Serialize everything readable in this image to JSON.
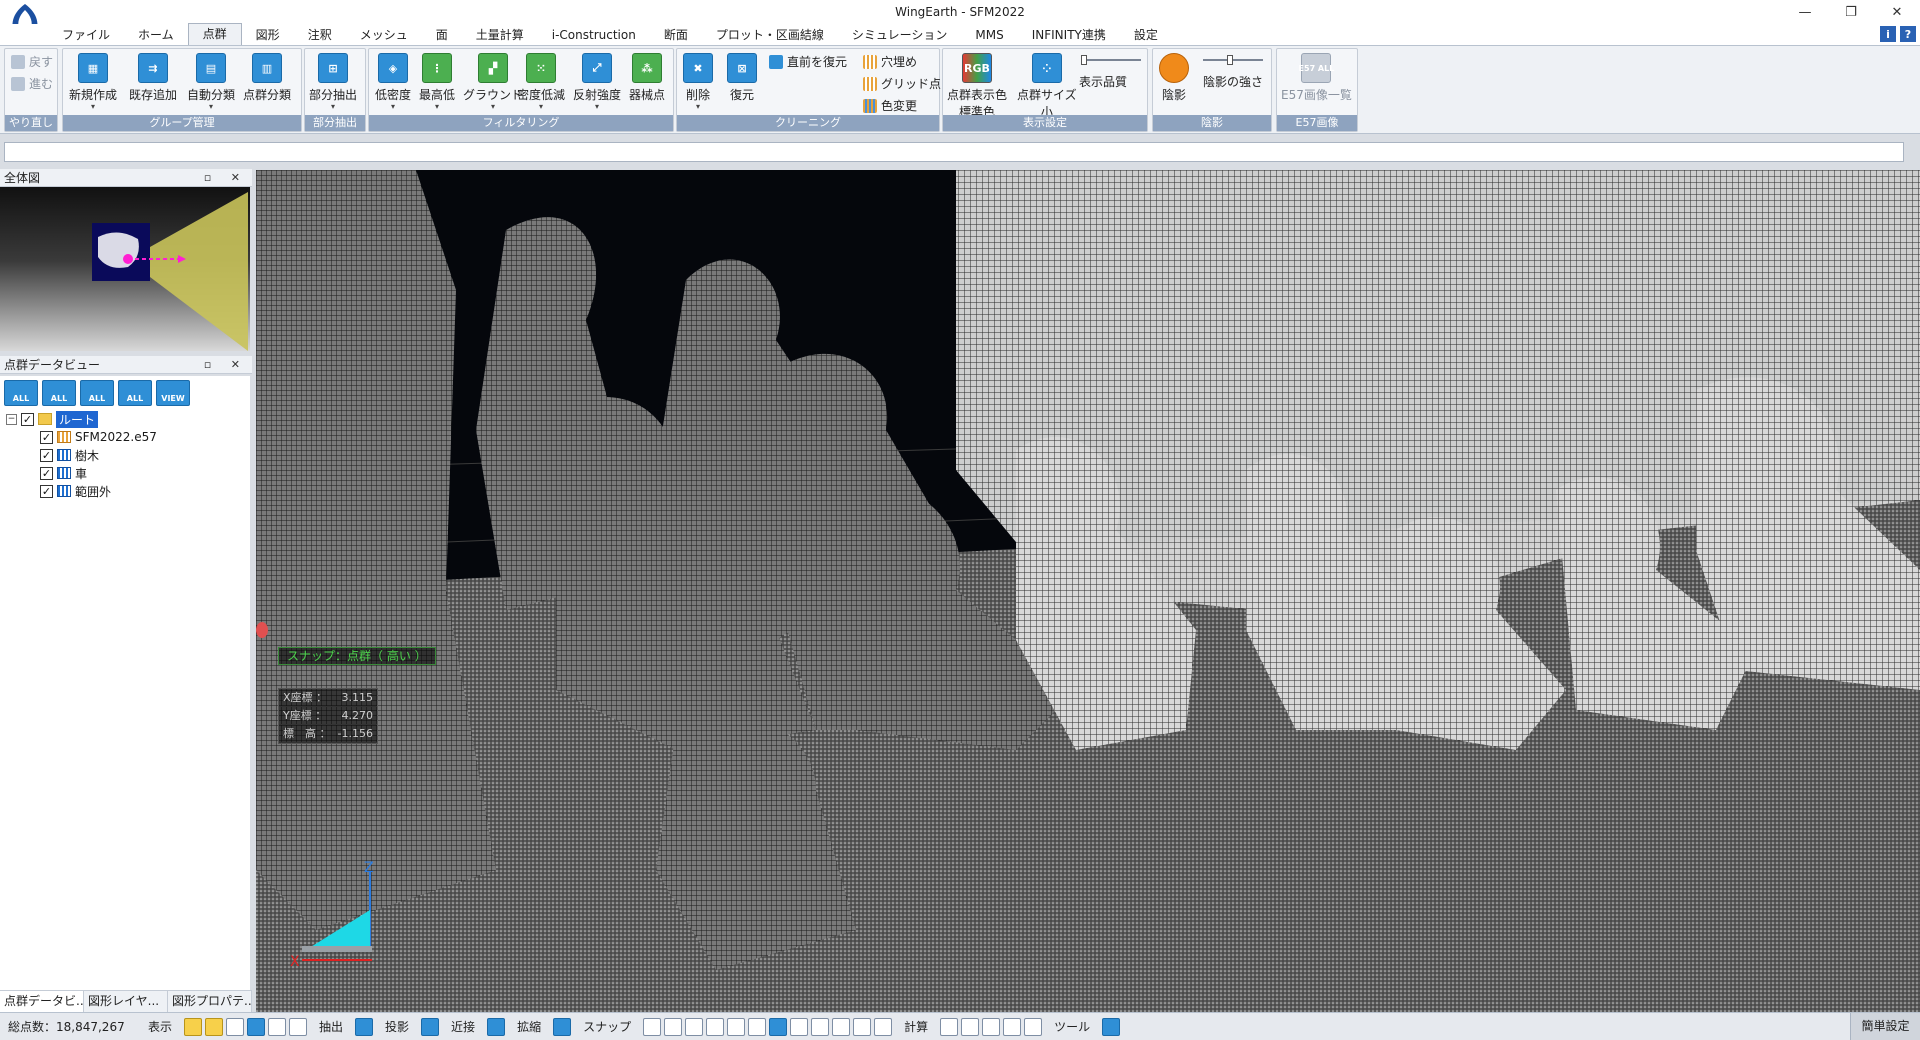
{
  "window": {
    "title": "WingEarth - SFM2022",
    "controls": [
      "—",
      "❐",
      "✕"
    ]
  },
  "menu": {
    "tabs": [
      "ファイル",
      "ホーム",
      "点群",
      "図形",
      "注釈",
      "メッシュ",
      "面",
      "土量計算",
      "i-Construction",
      "断面",
      "プロット・区画結線",
      "シミュレーション",
      "MMS",
      "INFINITY連携",
      "設定"
    ],
    "active": "点群",
    "help_icons": [
      "i",
      "?"
    ]
  },
  "ribbon": {
    "groups": {
      "undo": "やり直し",
      "group_mgmt": "グループ管理",
      "partial": "部分抽出",
      "filter": "フィルタリング",
      "cleaning": "クリーニング",
      "display": "表示設定",
      "shade": "陰影",
      "e57": "E57画像"
    },
    "undo": {
      "back": "戻す",
      "forward": "進む"
    },
    "group_mgmt": {
      "new": "新規作成",
      "add": "既存追加",
      "auto": "自動分類",
      "classify": "点群分類"
    },
    "partial": {
      "extract": "部分抽出"
    },
    "filter": {
      "low_density": "低密度",
      "highest_lowest": "最高低",
      "ground": "グラウンド",
      "density_reduce": "密度低減",
      "reflect": "反射強度",
      "instrument": "器械点"
    },
    "cleaning": {
      "delete": "削除",
      "restore": "復元",
      "restore_prev": "直前を復元",
      "fill": "穴埋め",
      "grid": "グリッド点",
      "color_change": "色変更"
    },
    "display": {
      "color": "点群表示色",
      "color_sub": "標準色",
      "size": "点群サイズ",
      "size_sub": "小",
      "quality": "表示品質"
    },
    "shade": {
      "shade": "陰影",
      "strength": "陰影の強さ"
    },
    "e57": {
      "list": "E57画像一覧",
      "icon": "E57 ALL"
    },
    "icon_labels": {
      "rgb": "RGB"
    }
  },
  "panels": {
    "overview": {
      "title": "全体図",
      "buttons": "▫ ✕"
    },
    "pc_view": {
      "title": "点群データビュー",
      "buttons": "▫ ✕",
      "toolbar": [
        "ALL",
        "ALL",
        "ALL",
        "ALL",
        "VIEW"
      ]
    },
    "tree": {
      "root": "ルート",
      "items": [
        {
          "label": "SFM2022.e57",
          "icon": "dots"
        },
        {
          "label": "樹木",
          "icon": "grid"
        },
        {
          "label": "車",
          "icon": "grid"
        },
        {
          "label": "範囲外",
          "icon": "grid"
        }
      ]
    },
    "bottom_tabs": [
      "点群データビ...",
      "図形レイヤ...",
      "図形プロパテ..."
    ]
  },
  "viewport": {
    "snap": "スナップ：点群（ 高い ）",
    "coords": [
      {
        "label": "X座標 ：",
        "value": "3.115"
      },
      {
        "label": "Y座標 ：",
        "value": "4.270"
      },
      {
        "label": "標　高 ：",
        "value": "-1.156"
      }
    ],
    "axis": {
      "x": "X",
      "z": "Z"
    }
  },
  "statusbar": {
    "total_label": "総点数：18,847,267",
    "display": "表示",
    "extract": "抽出",
    "projection": "投影",
    "near": "近接",
    "zoom": "拡縮",
    "snap": "スナップ",
    "calc": "計算",
    "tool": "ツール",
    "simple": "簡単設定"
  }
}
